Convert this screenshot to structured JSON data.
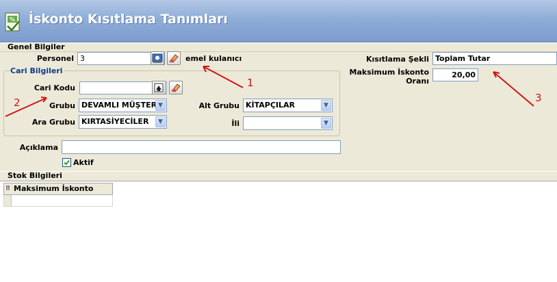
{
  "window": {
    "title": "İskonto Kısıtlama Tanımları"
  },
  "general": {
    "section_label": "Genel Bilgiler",
    "personel_label": "Personel",
    "personel_value": "3",
    "personel_description": "emel kulanıcı",
    "restriction_type_label": "Kısıtlama Şekli",
    "restriction_type_value": "Toplam Tutar",
    "max_discount_label_line1": "Maksimum İskonto",
    "max_discount_label_line2": "Oranı",
    "max_discount_value": "20,00"
  },
  "customer": {
    "group_title": "Cari Bilgileri",
    "code_label": "Cari Kodu",
    "code_value": "",
    "group_label": "Grubu",
    "group_value": "DEVAMLI MÜŞTERİ",
    "subgroup_label": "Alt Grubu",
    "subgroup_value": "KİTAPÇILAR",
    "midgroup_label": "Ara Grubu",
    "midgroup_value": "KIRTASİYECİLER",
    "city_label": "İli",
    "city_value": ""
  },
  "description": {
    "label": "Açıklama",
    "value": ""
  },
  "active": {
    "label": "Aktif",
    "checked": true
  },
  "stock": {
    "section_label": "Stok Bilgileri",
    "columns": [
      "Maksimum İskonto Oranı"
    ]
  },
  "annotations": {
    "one": "1",
    "two": "2",
    "three": "3"
  },
  "colors": {
    "annotation": "#d21414",
    "group_title": "#0b3c8a",
    "title_bar": "#8fadd8"
  }
}
